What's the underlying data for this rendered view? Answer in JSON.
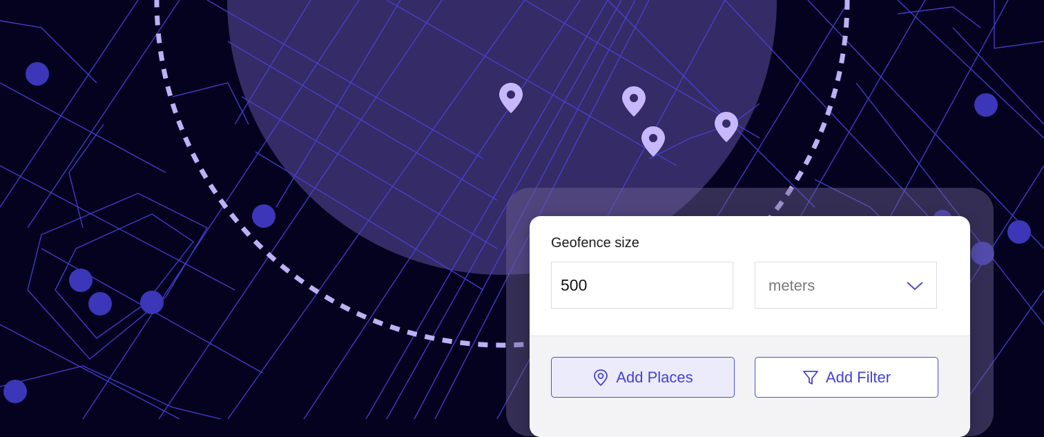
{
  "geofence": {
    "label": "Geofence size",
    "size_value": "500",
    "unit_value": "meters"
  },
  "actions": {
    "add_places_label": "Add Places",
    "add_filter_label": "Add Filter"
  },
  "map": {
    "marker_count": 4
  },
  "colors": {
    "background": "#04021f",
    "street": "#4a42d8",
    "radius_fill": "#352b66",
    "dashed_ring": "#bdb0f5",
    "marker": "#c6b8fb",
    "poi_dot": "#3b37b8",
    "accent": "#4d4bd6"
  }
}
